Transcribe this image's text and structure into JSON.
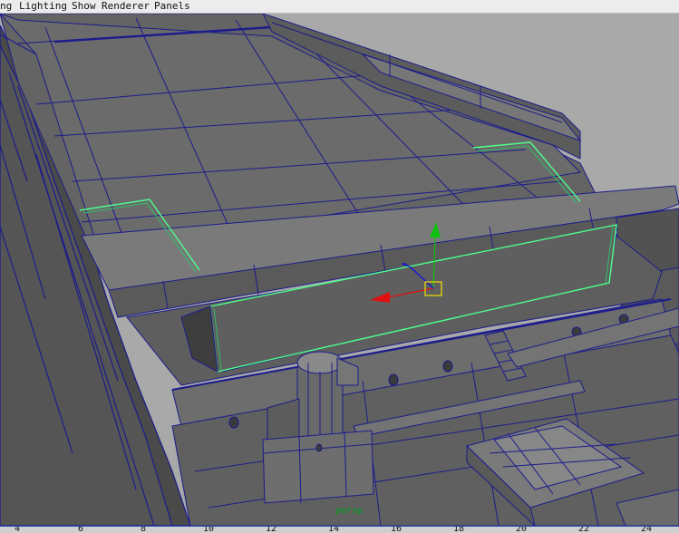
{
  "menubar": {
    "items": [
      {
        "id": "shading",
        "label": "ng"
      },
      {
        "id": "lighting",
        "label": "Lighting"
      },
      {
        "id": "show",
        "label": "Show"
      },
      {
        "id": "renderer",
        "label": "Renderer"
      },
      {
        "id": "panels",
        "label": "Panels"
      }
    ]
  },
  "viewport": {
    "camera_label": "persp",
    "background_color": "#a9a9a9",
    "wire_color": "#1c1c8c",
    "selection_color": "#4cff8c",
    "manipulator": {
      "x_axis_color": "#e01010",
      "y_axis_color": "#10c010",
      "z_axis_color": "#1010e0",
      "handle_color": "#f0e000"
    }
  },
  "timeline": {
    "ticks": [
      "4",
      "6",
      "8",
      "10",
      "12",
      "14",
      "16",
      "18",
      "20",
      "22",
      "24"
    ]
  }
}
